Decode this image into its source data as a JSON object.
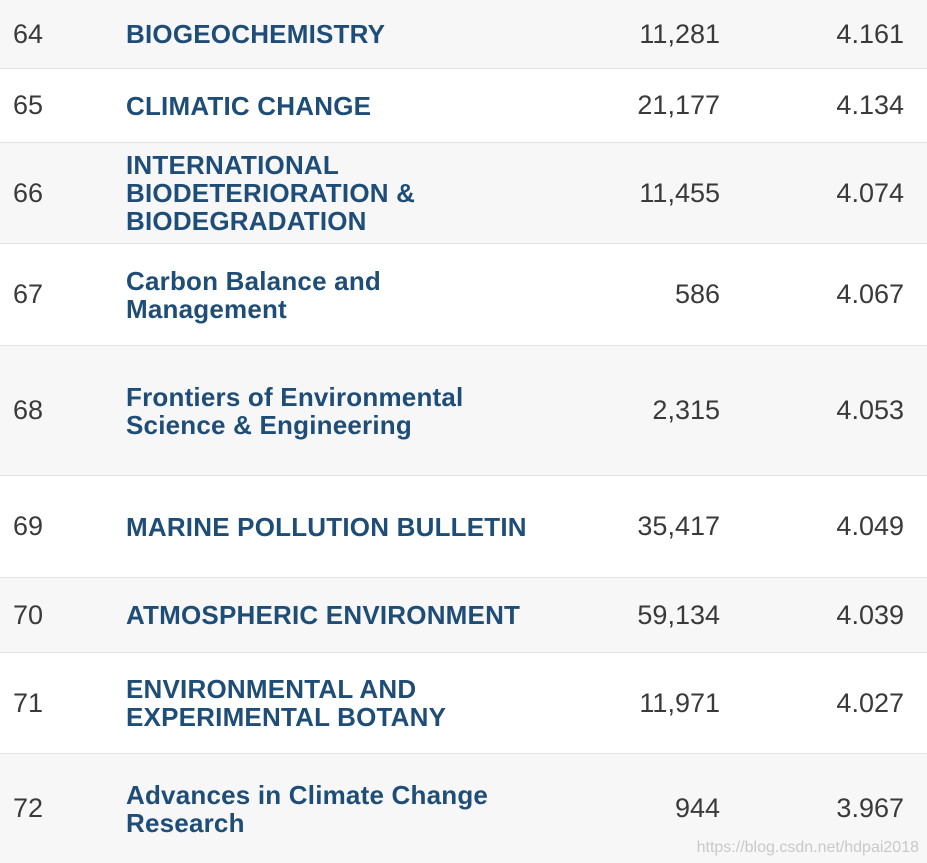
{
  "rows": [
    {
      "rank": "64",
      "title": "BIOGEOCHEMISTRY",
      "total_cites": "11,281",
      "impact_factor": "4.161"
    },
    {
      "rank": "65",
      "title": "CLIMATIC CHANGE",
      "total_cites": "21,177",
      "impact_factor": "4.134"
    },
    {
      "rank": "66",
      "title": "INTERNATIONAL BIODETERIORATION & BIODEGRADATION",
      "total_cites": "11,455",
      "impact_factor": "4.074"
    },
    {
      "rank": "67",
      "title": "Carbon Balance and Management",
      "total_cites": "586",
      "impact_factor": "4.067"
    },
    {
      "rank": "68",
      "title": "Frontiers of Environmental Science & Engineering",
      "total_cites": "2,315",
      "impact_factor": "4.053"
    },
    {
      "rank": "69",
      "title": "MARINE POLLUTION BULLETIN",
      "total_cites": "35,417",
      "impact_factor": "4.049"
    },
    {
      "rank": "70",
      "title": "ATMOSPHERIC ENVIRONMENT",
      "total_cites": "59,134",
      "impact_factor": "4.039"
    },
    {
      "rank": "71",
      "title": "ENVIRONMENTAL AND EXPERIMENTAL BOTANY",
      "total_cites": "11,971",
      "impact_factor": "4.027"
    },
    {
      "rank": "72",
      "title": "Advances in Climate Change Research",
      "total_cites": "944",
      "impact_factor": "3.967"
    }
  ],
  "watermark": "https://blog.csdn.net/hdpai2018"
}
